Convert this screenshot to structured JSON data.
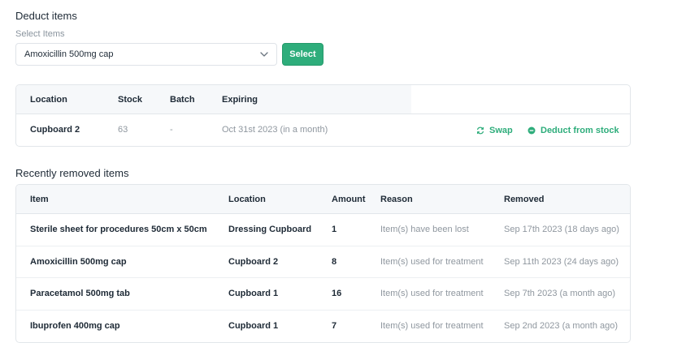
{
  "deduct": {
    "title": "Deduct items",
    "select_label": "Select Items",
    "selected_value": "Amoxicillin 500mg cap",
    "select_button": "Select",
    "columns": [
      "Location",
      "Stock",
      "Batch",
      "Expiring"
    ],
    "rows": [
      {
        "location": "Cupboard 2",
        "stock": "63",
        "batch": "-",
        "expiring": "Oct 31st 2023 (in a month)",
        "swap_label": "Swap",
        "deduct_label": "Deduct from stock"
      }
    ]
  },
  "removed": {
    "title": "Recently removed items",
    "columns": [
      "Item",
      "Location",
      "Amount",
      "Reason",
      "Removed"
    ],
    "rows": [
      {
        "item": "Sterile sheet for procedures 50cm x 50cm",
        "location": "Dressing Cupboard",
        "amount": "1",
        "reason": "Item(s) have been lost",
        "removed": "Sep 17th 2023 (18 days ago)"
      },
      {
        "item": "Amoxicillin 500mg cap",
        "location": "Cupboard 2",
        "amount": "8",
        "reason": "Item(s) used for treatment",
        "removed": "Sep 11th 2023 (24 days ago)"
      },
      {
        "item": "Paracetamol 500mg tab",
        "location": "Cupboard 1",
        "amount": "16",
        "reason": "Item(s) used for treatment",
        "removed": "Sep 7th 2023 (a month ago)"
      },
      {
        "item": "Ibuprofen 400mg cap",
        "location": "Cupboard 1",
        "amount": "7",
        "reason": "Item(s) used for treatment",
        "removed": "Sep 2nd 2023 (a month ago)"
      }
    ]
  },
  "icons": {
    "select_chevron": "chevron-down-icon",
    "swap": "swap-icon",
    "deduct": "minus-circle-icon"
  },
  "colors": {
    "accent": "#2ead7b",
    "header_bg": "#f6f8fa",
    "muted_text": "#8f979f"
  }
}
